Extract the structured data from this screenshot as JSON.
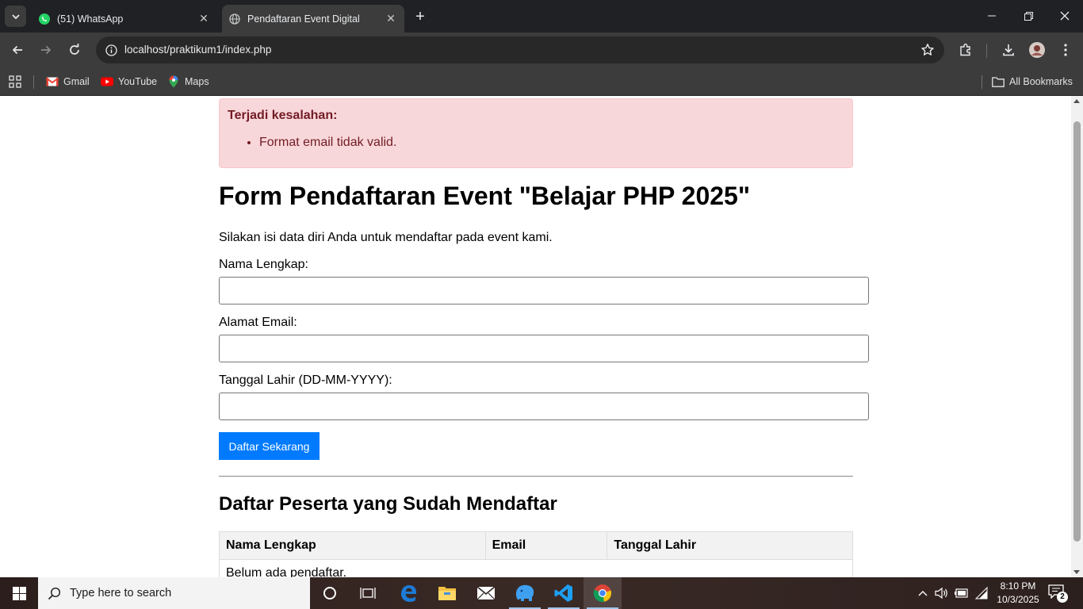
{
  "browser": {
    "tabs": [
      {
        "title": "(51) WhatsApp",
        "active": false
      },
      {
        "title": "Pendaftaran Event Digital",
        "active": true
      }
    ],
    "url": "localhost/praktikum1/index.php",
    "bookmarks": [
      {
        "label": "Gmail",
        "icon": "gmail-icon"
      },
      {
        "label": "YouTube",
        "icon": "youtube-icon"
      },
      {
        "label": "Maps",
        "icon": "maps-icon"
      }
    ],
    "all_bookmarks_label": "All Bookmarks"
  },
  "page": {
    "alert": {
      "title": "Terjadi kesalahan:",
      "errors": [
        "Format email tidak valid."
      ]
    },
    "title": "Form Pendaftaran Event \"Belajar PHP 2025\"",
    "intro": "Silakan isi data diri Anda untuk mendaftar pada event kami.",
    "form": {
      "name_label": "Nama Lengkap:",
      "name_value": "",
      "email_label": "Alamat Email:",
      "email_value": "",
      "birth_label": "Tanggal Lahir (DD-MM-YYYY):",
      "birth_value": "",
      "submit_label": "Daftar Sekarang"
    },
    "participants": {
      "title": "Daftar Peserta yang Sudah Mendaftar",
      "columns": [
        "Nama Lengkap",
        "Email",
        "Tanggal Lahir"
      ],
      "empty_text": "Belum ada pendaftar."
    }
  },
  "taskbar": {
    "search_placeholder": "Type here to search",
    "time": "8:10 PM",
    "date": "10/3/2025",
    "notification_count": "2"
  },
  "colors": {
    "alert_bg": "#f8d7da",
    "alert_text": "#721c24",
    "button_bg": "#007bff",
    "chrome_dark": "#202124",
    "chrome_toolbar": "#3c3c3c"
  }
}
